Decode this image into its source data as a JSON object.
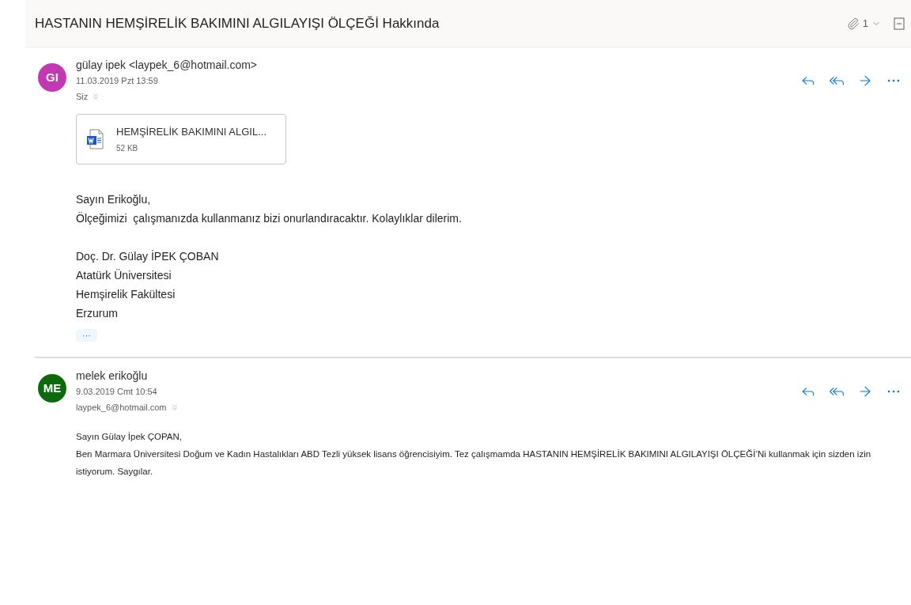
{
  "subject": {
    "title": "HASTANIN HEMŞİRELİK BAKIMINI ALGILAYIŞI ÖLÇEĞİ Hakkında",
    "attachment_count": "1"
  },
  "messages": [
    {
      "initials": "GI",
      "color": "#c239b3",
      "sender": "gülay ipek <laypek_6@hotmail.com>",
      "date": "11.03.2019 Pzt 13:59",
      "to": "Siz",
      "attachments": [
        {
          "name": "HEMŞİRELİK BAKIMINI ALGIL...",
          "size": "52 KB"
        }
      ],
      "paragraphs": [
        {
          "kind": "lines",
          "lines": [
            "Sayın Erikoğlu,",
            "Ölçeğimizi  çalışmanızda kullanmanız bizi onurlandıracaktır. Kolaylıklar dilerim."
          ]
        },
        {
          "kind": "lines",
          "lines": [
            "Doç. Dr. Gülay İPEK ÇOBAN",
            "Atatürk Üniversitesi",
            "Hemşirelik Fakültesi",
            "Erzurum"
          ]
        }
      ],
      "show_more": "···"
    },
    {
      "initials": "ME",
      "color": "#0b6a0b",
      "sender": "melek erikoğlu",
      "date": "9.03.2019 Cmt 10:54",
      "to": "laypek_6@hotmail.com",
      "paragraphs": [
        {
          "kind": "small",
          "lines": [
            "Sayın Gülay İpek ÇOPAN,",
            "Ben Marmara Üniversitesi Doğum ve Kadın Hastalıkları ABD Tezli yüksek lisans öğrencisiyim. Tez çalışmamda HASTANIN HEMŞİRELİK BAKIMINI ALGILAYIŞI ÖLÇEĞİ’Ni kullanmak için sizden izin istiyorum. Saygılar."
          ]
        }
      ]
    }
  ]
}
